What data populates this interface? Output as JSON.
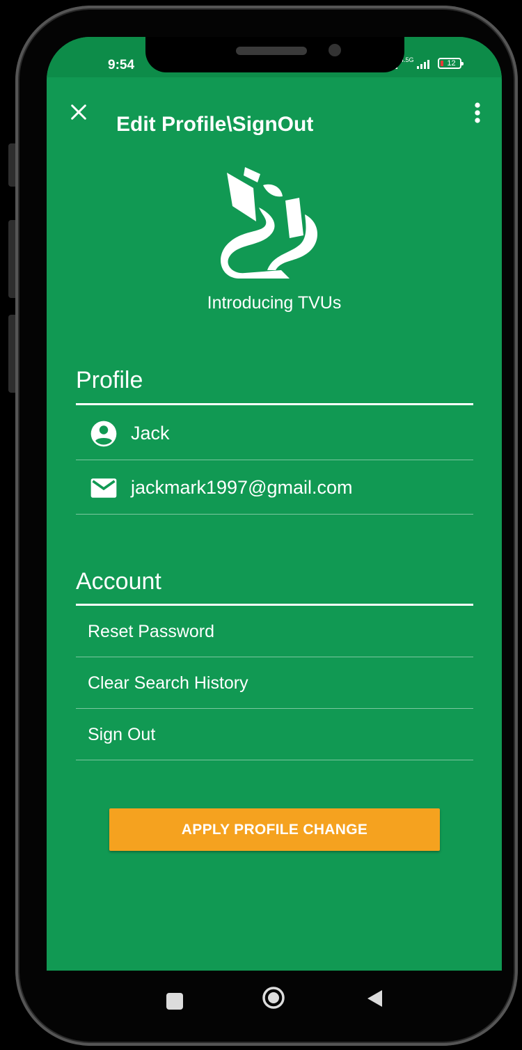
{
  "status_bar": {
    "time": "9:54",
    "network": "4.5G",
    "battery": "12"
  },
  "app_bar": {
    "title": "Edit Profile\\SignOut"
  },
  "brand": {
    "tagline": "Introducing TVUs"
  },
  "profile": {
    "heading": "Profile",
    "name": "Jack",
    "email": "jackmark1997@gmail.com"
  },
  "account": {
    "heading": "Account",
    "items": [
      {
        "label": "Reset Password"
      },
      {
        "label": "Clear Search History"
      },
      {
        "label": "Sign Out"
      }
    ]
  },
  "apply_button": {
    "label": "APPLY PROFILE CHANGE"
  },
  "colors": {
    "primary": "#119953",
    "status_bar": "#0d8c49",
    "accent": "#f5a21f"
  },
  "icons": [
    "close-icon",
    "more-vert-icon",
    "account-circle-icon",
    "email-icon",
    "nav-recents-icon",
    "nav-home-icon",
    "nav-back-icon"
  ]
}
